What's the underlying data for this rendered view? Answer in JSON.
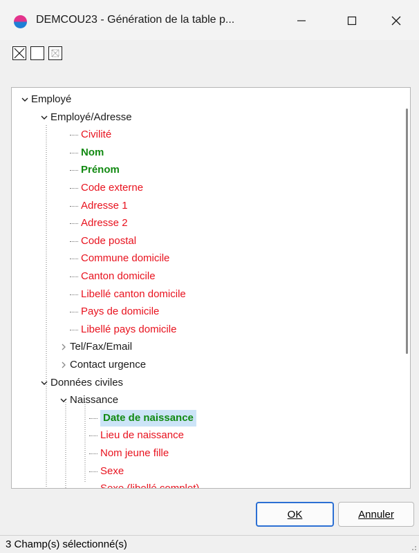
{
  "window": {
    "title": "DEMCOU23 - Génération de la table p...",
    "minimize_icon": "minimize-icon",
    "maximize_icon": "maximize-icon",
    "close_icon": "close-icon"
  },
  "toolbar": {
    "buttons": [
      {
        "name": "select-all-button",
        "icon": "checkbox-crossed-icon"
      },
      {
        "name": "deselect-all-button",
        "icon": "checkbox-empty-icon"
      },
      {
        "name": "invert-selection-button",
        "icon": "checkbox-dotted-icon"
      }
    ]
  },
  "tree": {
    "items": [
      {
        "label": "Employé",
        "kind": "node",
        "expanded": true,
        "depth": 0
      },
      {
        "label": "Employé/Adresse",
        "kind": "node",
        "expanded": true,
        "depth": 1
      },
      {
        "label": "Civilité",
        "kind": "leaf",
        "state": "red",
        "depth": 2
      },
      {
        "label": "Nom",
        "kind": "leaf",
        "state": "green",
        "depth": 2
      },
      {
        "label": "Prénom",
        "kind": "leaf",
        "state": "green",
        "depth": 2
      },
      {
        "label": "Code externe",
        "kind": "leaf",
        "state": "red",
        "depth": 2
      },
      {
        "label": "Adresse 1",
        "kind": "leaf",
        "state": "red",
        "depth": 2
      },
      {
        "label": "Adresse 2",
        "kind": "leaf",
        "state": "red",
        "depth": 2
      },
      {
        "label": "Code postal",
        "kind": "leaf",
        "state": "red",
        "depth": 2
      },
      {
        "label": "Commune domicile",
        "kind": "leaf",
        "state": "red",
        "depth": 2
      },
      {
        "label": "Canton domicile",
        "kind": "leaf",
        "state": "red",
        "depth": 2
      },
      {
        "label": "Libellé canton domicile",
        "kind": "leaf",
        "state": "red",
        "depth": 2
      },
      {
        "label": "Pays de domicile",
        "kind": "leaf",
        "state": "red",
        "depth": 2
      },
      {
        "label": "Libellé pays domicile",
        "kind": "leaf",
        "state": "red",
        "depth": 2
      },
      {
        "label": "Tel/Fax/Email",
        "kind": "node",
        "expanded": false,
        "depth": 2
      },
      {
        "label": "Contact urgence",
        "kind": "node",
        "expanded": false,
        "depth": 2
      },
      {
        "label": "Données civiles",
        "kind": "node",
        "expanded": true,
        "depth": 1
      },
      {
        "label": "Naissance",
        "kind": "node",
        "expanded": true,
        "depth": 2
      },
      {
        "label": "Date de naissance",
        "kind": "leaf",
        "state": "green",
        "selected": true,
        "depth": 3
      },
      {
        "label": "Lieu de naissance",
        "kind": "leaf",
        "state": "red",
        "depth": 3
      },
      {
        "label": "Nom jeune fille",
        "kind": "leaf",
        "state": "red",
        "depth": 3
      },
      {
        "label": "Sexe",
        "kind": "leaf",
        "state": "red",
        "depth": 3
      },
      {
        "label": "Sexe (libellé complet)",
        "kind": "leaf",
        "state": "red",
        "depth": 3
      }
    ]
  },
  "buttons": {
    "ok_label": "OK",
    "cancel_label": "Annuler"
  },
  "status": {
    "text": "3 Champ(s) sélectionné(s)"
  },
  "colors": {
    "unselected": "#e8121e",
    "selected": "#128a12",
    "highlight": "#cce4f7",
    "accent": "#2b6fd3"
  }
}
